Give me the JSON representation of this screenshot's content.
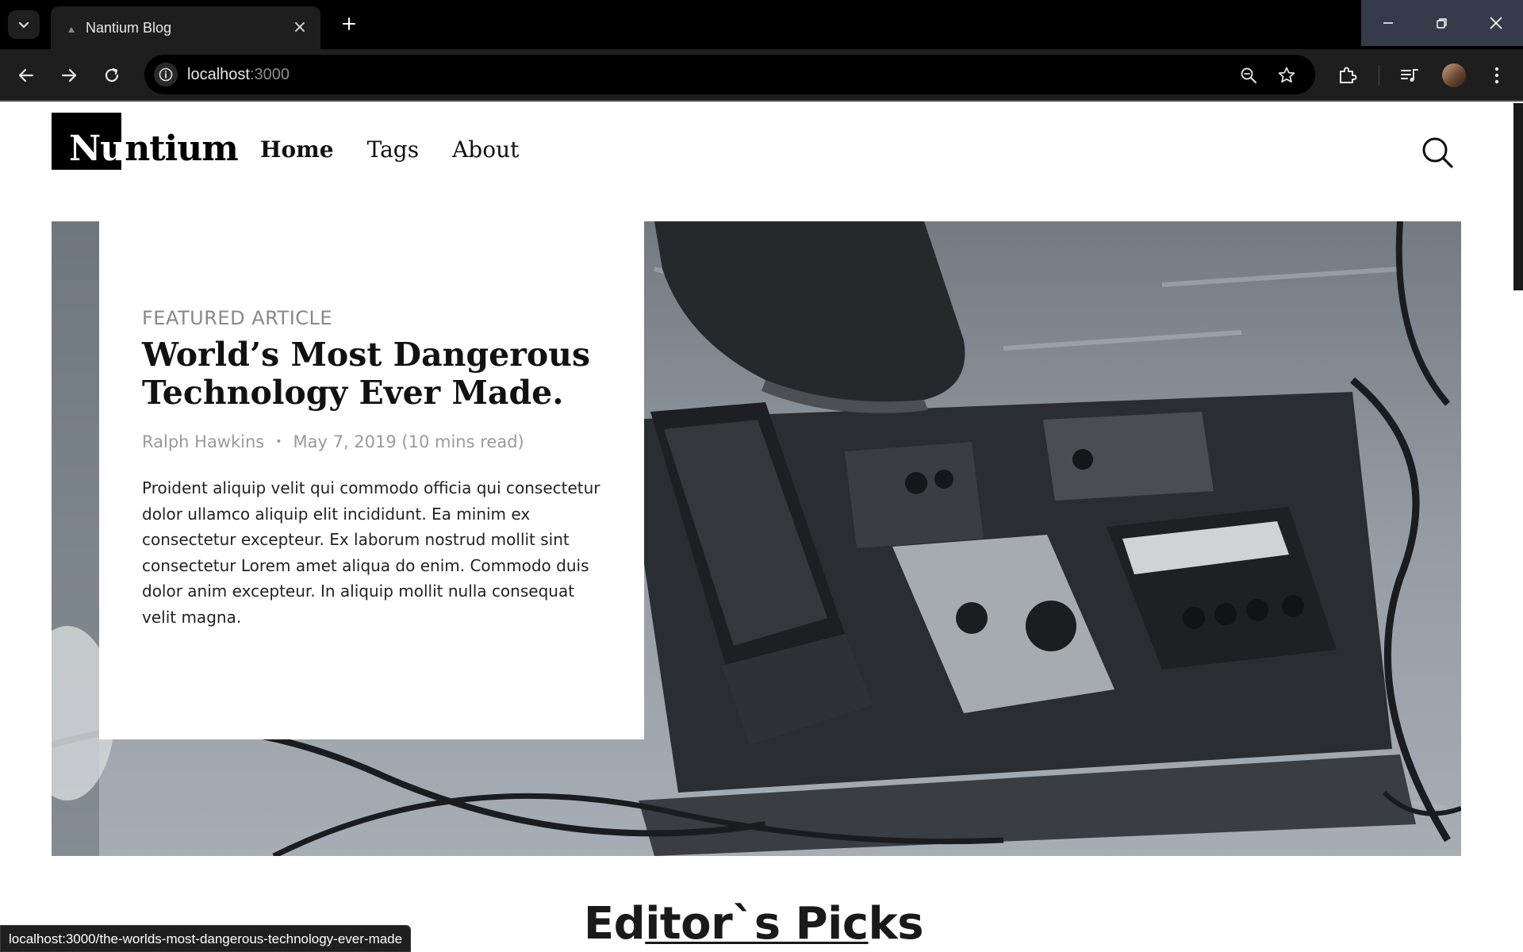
{
  "browser": {
    "tab": {
      "title": "Nantium Blog"
    },
    "address": {
      "host": "localhost",
      "port": ":3000"
    },
    "status_url": "localhost:3000/the-worlds-most-dangerous-technology-ever-made"
  },
  "site": {
    "logo": {
      "inverted": "Nu",
      "rest": "ntium"
    },
    "nav": [
      {
        "label": "Home",
        "active": true
      },
      {
        "label": "Tags",
        "active": false
      },
      {
        "label": "About",
        "active": false
      }
    ]
  },
  "featured": {
    "kicker": "FEATURED ARTICLE",
    "title": "World’s Most Dangerous Technology Ever Made.",
    "author": "Ralph Hawkins",
    "separator": "•",
    "date": "May 7, 2019 (10 mins read)",
    "excerpt": "Proident aliquip velit qui commodo officia qui consectetur dolor ullamco aliquip elit incididunt. Ea minim ex consectetur excepteur. Ex laborum nostrud mollit sint consectetur Lorem amet aliqua do enim. Commodo duis dolor anim excepteur. In aliquip mollit nulla consequat velit magna."
  },
  "sections": {
    "editors_picks_pre": "Ed",
    "editors_picks_underlined": "itor`s Pic",
    "editors_picks_post": "ks"
  },
  "colors": {
    "chrome_bg": "#000000",
    "toolbar_bg": "#1e1e1e",
    "page_bg": "#ffffff",
    "text_dark": "#111111",
    "muted": "#9a9a9a"
  }
}
